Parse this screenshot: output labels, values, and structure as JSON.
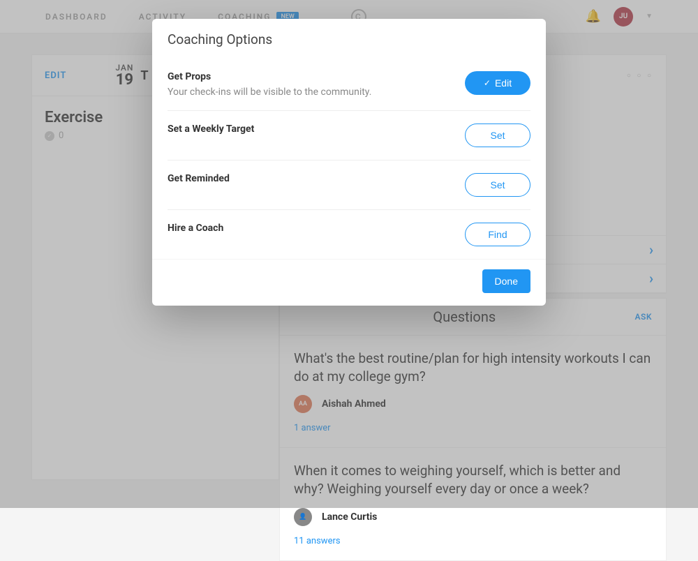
{
  "nav": {
    "links": [
      "DASHBOARD",
      "ACTIVITY",
      "COACHING"
    ],
    "badge": "NEW",
    "userInitials": "JU"
  },
  "dateCard": {
    "edit": "EDIT",
    "month": "JAN",
    "day": "19",
    "today": "T"
  },
  "exercise": {
    "title": "Exercise",
    "count": "0"
  },
  "questions": {
    "title": "Questions",
    "ask": "ASK",
    "items": [
      {
        "text": "What's the best routine/plan for high intensity workouts I can do at my college gym?",
        "author": "Aishah Ahmed",
        "initials": "AA",
        "answers": "1 answer"
      },
      {
        "text": "When it comes to weighing yourself, which is better and why? Weighing yourself every day or once a week?",
        "author": "Lance Curtis",
        "initials": "",
        "answers": "11 answers"
      }
    ]
  },
  "modal": {
    "title": "Coaching Options",
    "options": [
      {
        "title": "Get Props",
        "desc": "Your check-ins will be visible to the community.",
        "button": "Edit",
        "solid": true,
        "check": true
      },
      {
        "title": "Set a Weekly Target",
        "desc": "",
        "button": "Set",
        "solid": false,
        "check": false
      },
      {
        "title": "Get Reminded",
        "desc": "",
        "button": "Set",
        "solid": false,
        "check": false
      },
      {
        "title": "Hire a Coach",
        "desc": "",
        "button": "Find",
        "solid": false,
        "check": false
      }
    ],
    "done": "Done"
  }
}
